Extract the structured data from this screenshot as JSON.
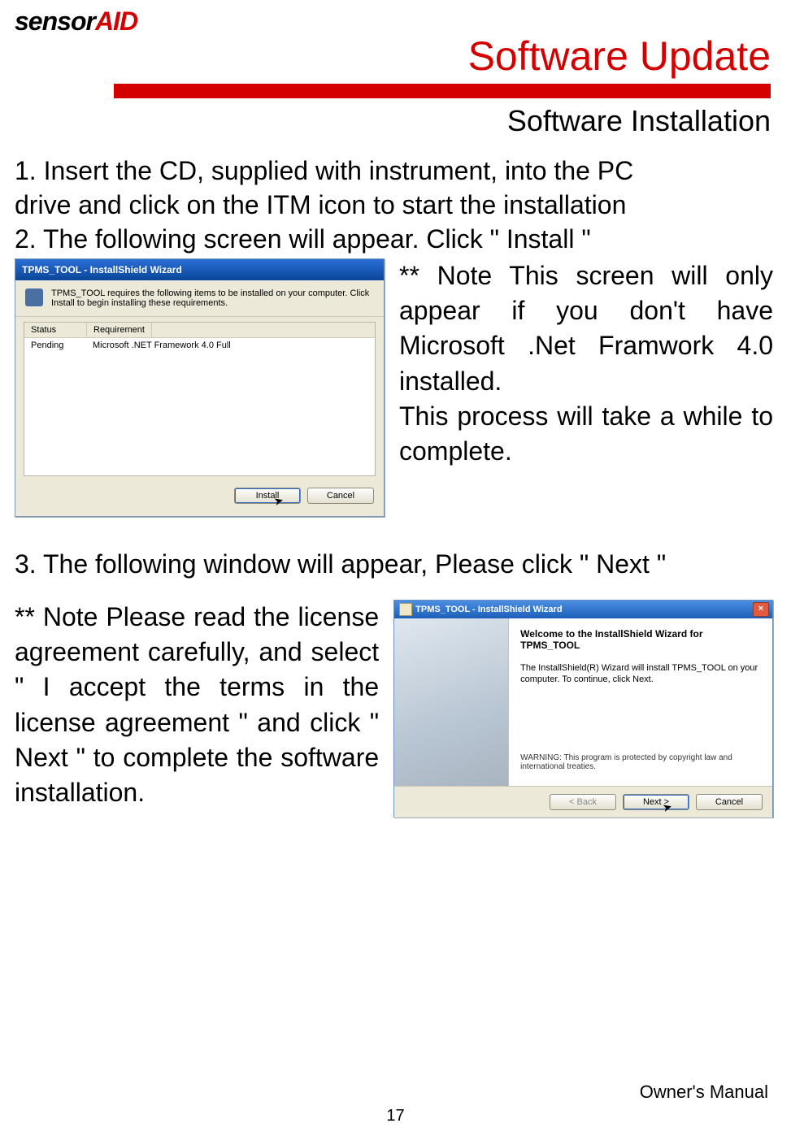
{
  "brand": {
    "sensor": "sensor",
    "aid": "AID"
  },
  "title": "Software Update",
  "subtitle": "Software Installation",
  "steps": {
    "s1": "1. Insert the CD, supplied with instrument, into the PC\n    drive and click on the ITM icon to start the installation",
    "s2": "2. The following screen will appear. Click \" Install \"",
    "s3": "3. The following window will appear, Please click \" Next \""
  },
  "note1": "** Note   This screen will only appear if you don't have Microsoft .Net Framwork 4.0 installed.\nThis process will take a while to complete.",
  "note2": "** Note   Please read the license agreement carefully, and select \" I accept the terms in the license agreement \" and click \" Next \" to complete the software installation.",
  "dialog1": {
    "title": "TPMS_TOOL - InstallShield Wizard",
    "banner": "TPMS_TOOL requires the following items to be installed on your computer. Click Install to begin installing these requirements.",
    "columns": {
      "status": "Status",
      "requirement": "Requirement"
    },
    "row": {
      "status": "Pending",
      "requirement": "Microsoft .NET Framework 4.0 Full"
    },
    "buttons": {
      "install": "Install",
      "cancel": "Cancel"
    }
  },
  "dialog2": {
    "title": "TPMS_TOOL - InstallShield Wizard",
    "welcome_head": "Welcome to the InstallShield Wizard for TPMS_TOOL",
    "welcome_para": "The InstallShield(R) Wizard will install TPMS_TOOL on your computer. To continue, click Next.",
    "warning": "WARNING: This program is protected by copyright law and international treaties.",
    "buttons": {
      "back": "< Back",
      "next": "Next >",
      "cancel": "Cancel"
    }
  },
  "footer": {
    "manual": "Owner's Manual",
    "page": "17"
  }
}
